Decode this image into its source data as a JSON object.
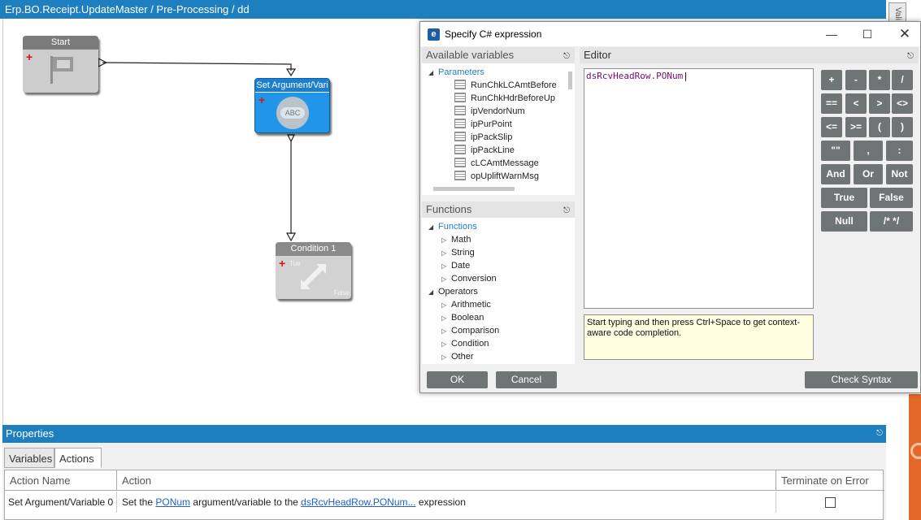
{
  "breadcrumb": "Erp.BO.Receipt.UpdateMaster / Pre-Processing / dd",
  "right_tab_label": "Vali",
  "workflow": {
    "start_label": "Start",
    "set_label": "Set Argument/Vari",
    "set_icon_text": "ABC",
    "condition_label": "Condition 1",
    "true_label": "Tue",
    "false_label": "False"
  },
  "dialog": {
    "title": "Specify C# expression",
    "available_variables_header": "Available variables",
    "parameters_label": "Parameters",
    "parameters": [
      "RunChkLCAmtBefore",
      "RunChkHdrBeforeUp",
      "ipVendorNum",
      "ipPurPoint",
      "ipPackSlip",
      "ipPackLine",
      "cLCAmtMessage",
      "opUpliftWarnMsg"
    ],
    "functions_header": "Functions",
    "functions_root": "Functions",
    "functions": [
      "Math",
      "String",
      "Date",
      "Conversion"
    ],
    "operators_root": "Operators",
    "operators": [
      "Arithmetic",
      "Boolean",
      "Comparison",
      "Condition",
      "Other"
    ],
    "editor_header": "Editor",
    "expression": "dsRcvHeadRow.PONum",
    "hint": "Start typing and then press Ctrl+Space to get context-aware code completion.",
    "keypad_rows": [
      [
        "+",
        "-",
        "*",
        "/"
      ],
      [
        "==",
        "<",
        ">",
        "<>"
      ],
      [
        "<=",
        ">=",
        "(",
        ")"
      ],
      [
        "\"\"",
        ",",
        ":"
      ],
      [
        "And",
        "Or",
        "Not"
      ],
      [
        "True",
        "False"
      ],
      [
        "Null",
        "/* */"
      ]
    ],
    "ok_label": "OK",
    "cancel_label": "Cancel",
    "check_syntax_label": "Check Syntax"
  },
  "properties": {
    "header": "Properties",
    "tabs": [
      "Variables",
      "Actions"
    ],
    "active_tab": "Actions",
    "columns": [
      "Action Name",
      "Action",
      "Terminate on Error"
    ],
    "rows": [
      {
        "name": "Set Argument/Variable 0",
        "action_prefix": "Set the ",
        "action_link1": "PONum",
        "action_middle": " argument/variable to the ",
        "action_link2": "dsRcvHeadRow.PONum...",
        "action_suffix": " expression",
        "terminate": false
      }
    ]
  }
}
